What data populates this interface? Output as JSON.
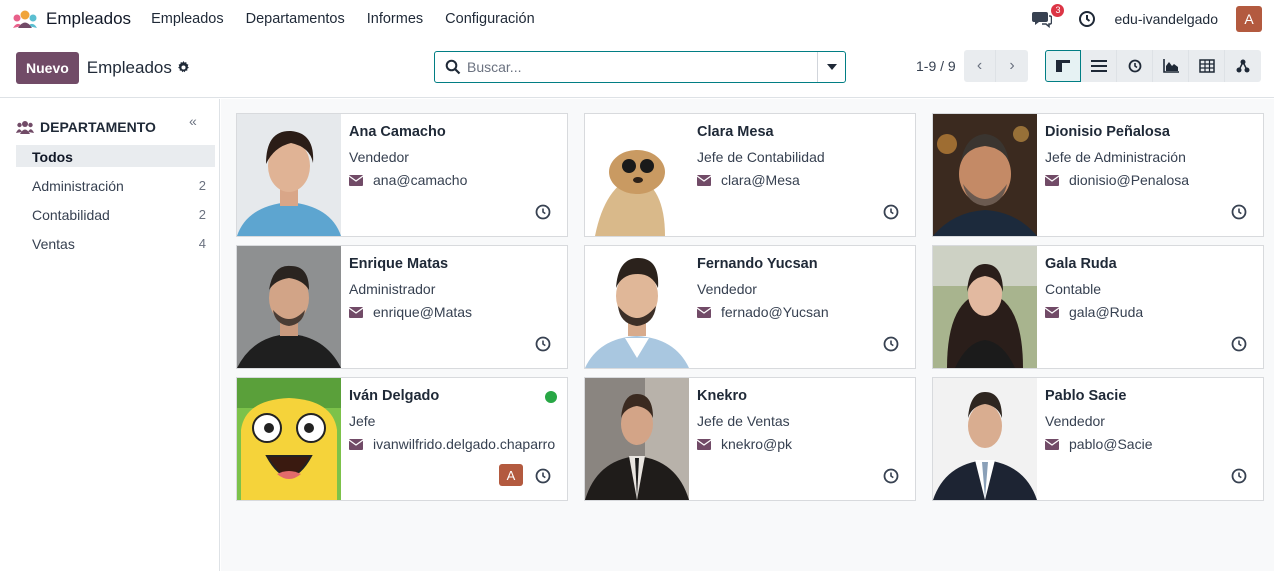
{
  "app": {
    "name": "Empleados"
  },
  "menu": [
    "Empleados",
    "Departamentos",
    "Informes",
    "Configuración"
  ],
  "topbar": {
    "chat_count": "3",
    "user": "edu-ivandelgado",
    "avatar_letter": "A"
  },
  "control": {
    "new_label": "Nuevo",
    "title": "Empleados",
    "search_placeholder": "Buscar...",
    "pager": "1-9 / 9"
  },
  "sidebar": {
    "heading": "DEPARTAMENTO",
    "items": [
      {
        "label": "Todos",
        "count": ""
      },
      {
        "label": "Administración",
        "count": "2"
      },
      {
        "label": "Contabilidad",
        "count": "2"
      },
      {
        "label": "Ventas",
        "count": "4"
      }
    ]
  },
  "employees": [
    {
      "name": "Ana Camacho",
      "job": "Vendedor",
      "email": "ana@camacho"
    },
    {
      "name": "Clara Mesa",
      "job": "Jefe de Contabilidad",
      "email": "clara@Mesa"
    },
    {
      "name": "Dionisio Peñalosa",
      "job": "Jefe de Administración",
      "email": "dionisio@Penalosa"
    },
    {
      "name": "Enrique Matas",
      "job": "Administrador",
      "email": "enrique@Matas"
    },
    {
      "name": "Fernando Yucsan",
      "job": "Vendedor",
      "email": "fernado@Yucsan"
    },
    {
      "name": "Gala Ruda",
      "job": "Contable",
      "email": "gala@Ruda"
    },
    {
      "name": "Iván Delgado",
      "job": "Jefe",
      "email": "ivanwilfrido.delgado.chaparro",
      "avatar_letter": "A"
    },
    {
      "name": "Knekro",
      "job": "Jefe de Ventas",
      "email": "knekro@pk"
    },
    {
      "name": "Pablo Sacie",
      "job": "Vendedor",
      "email": "pablo@Sacie"
    }
  ],
  "colors": {
    "brand": "#714b67",
    "accent": "#017e84",
    "badge": "#dc3545",
    "avatar": "#b35a3f",
    "online": "#28a745"
  }
}
